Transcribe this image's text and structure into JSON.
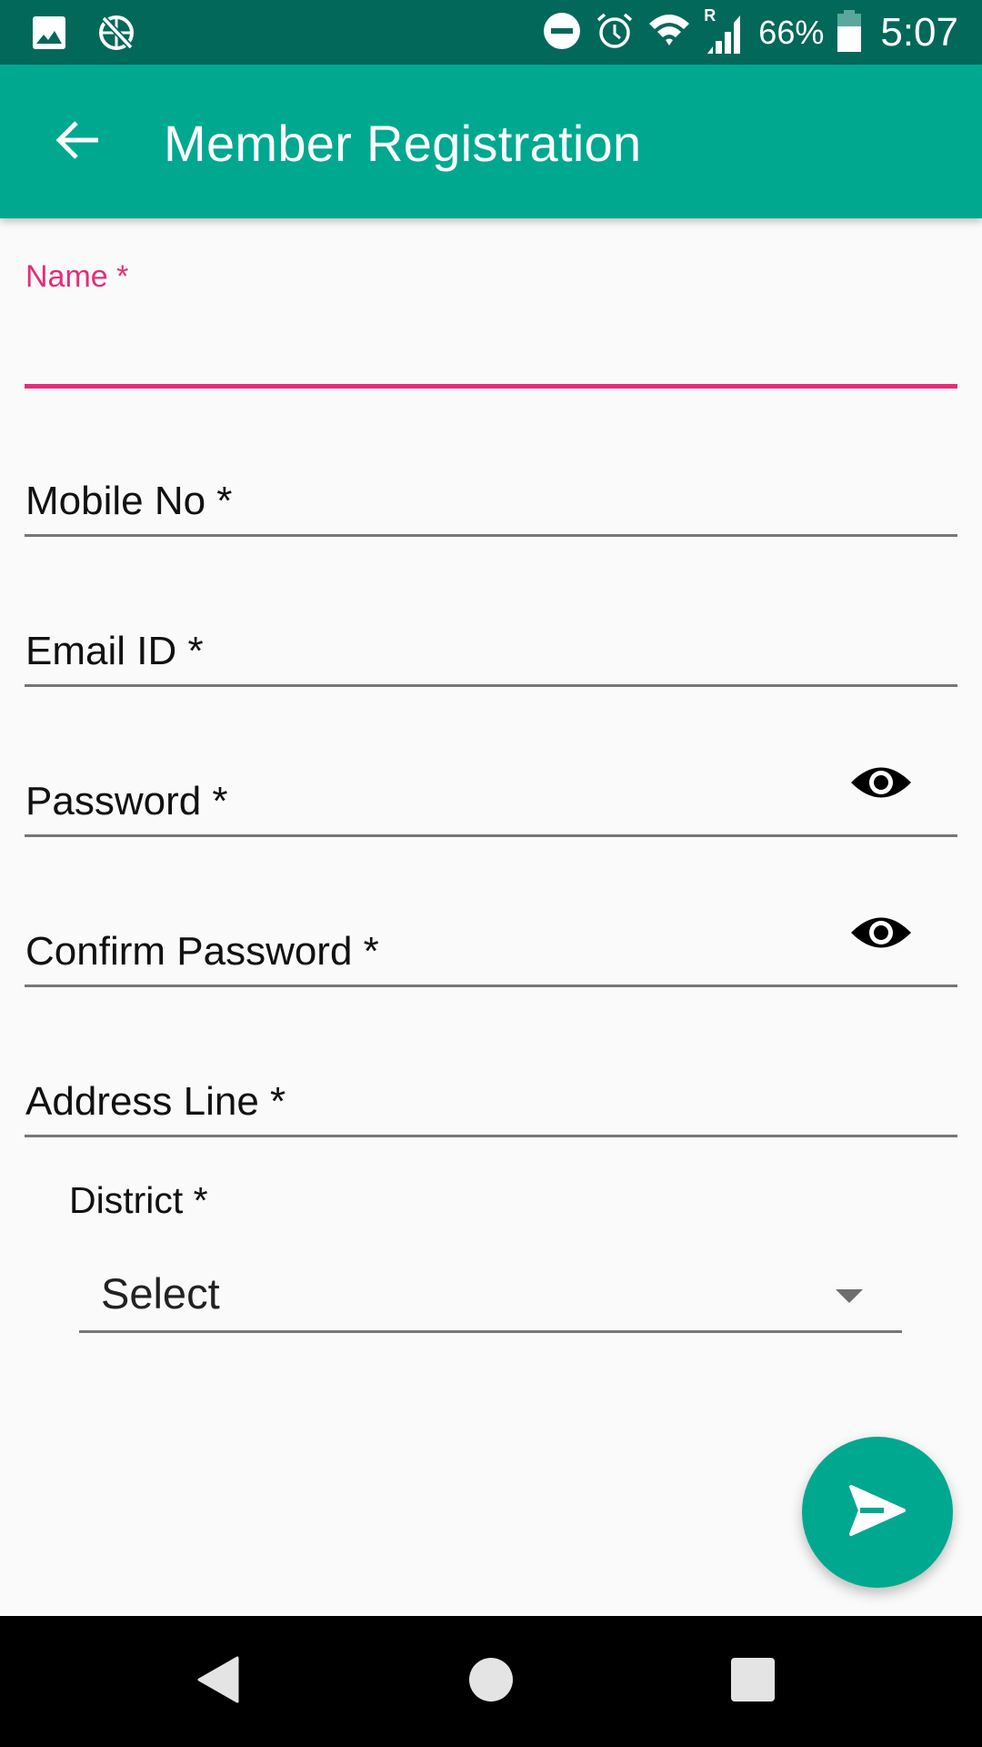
{
  "status_bar": {
    "left_icons": [
      "gallery-icon",
      "no-network-globe-icon"
    ],
    "right_icons": [
      "do-not-disturb-icon",
      "alarm-icon",
      "wifi-icon",
      "cellular-roaming-icon",
      "battery-icon"
    ],
    "roaming_indicator": "R",
    "battery_percent": "66%",
    "battery_level": 0.66,
    "time": "5:07"
  },
  "app_bar": {
    "back_icon": "arrow-back-icon",
    "title": "Member Registration"
  },
  "form": {
    "name": {
      "label": "Name *",
      "value": "",
      "focused": true
    },
    "mobile": {
      "label": "Mobile No *",
      "value": ""
    },
    "email": {
      "label": "Email ID *",
      "value": ""
    },
    "password": {
      "label": "Password *",
      "value": "",
      "toggle_icon": "eye-icon"
    },
    "confirm_password": {
      "label": "Confirm Password *",
      "value": "",
      "toggle_icon": "eye-icon"
    },
    "address": {
      "label": "Address Line *",
      "value": ""
    },
    "district": {
      "label": "District *",
      "selected": "Select"
    }
  },
  "fab": {
    "icon": "send-icon"
  },
  "nav_bar": {
    "buttons": [
      "back",
      "home",
      "recents"
    ]
  },
  "colors": {
    "status_bar": "#02685a",
    "primary": "#00a890",
    "accent": "#e32d7a",
    "background": "#fafafa",
    "underline": "#777777"
  }
}
